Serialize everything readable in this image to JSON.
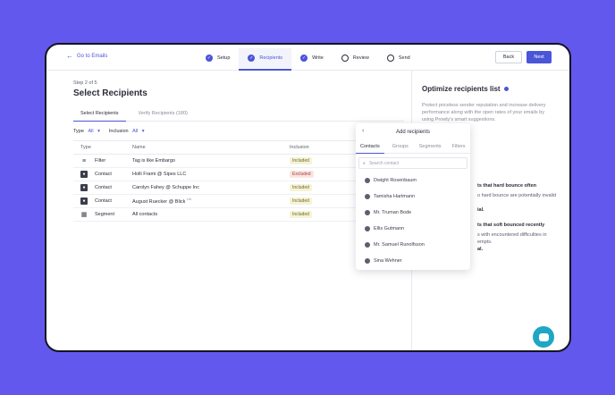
{
  "topbar": {
    "back_label": "Go to Emails",
    "steps": [
      {
        "label": "Setup",
        "done": true
      },
      {
        "label": "Recipients",
        "done": true,
        "active": true
      },
      {
        "label": "Write",
        "done": true
      },
      {
        "label": "Review",
        "done": false
      },
      {
        "label": "Send",
        "done": false
      }
    ],
    "back_button": "Back",
    "next_button": "Next"
  },
  "main": {
    "step_of": "Step 2 of 5",
    "title": "Select Recipients",
    "tabs": [
      "Select Recipients",
      "Verify Recipients (180)"
    ],
    "filters": {
      "type_label": "Type",
      "type_value": "All",
      "inclusion_label": "Inclusion",
      "inclusion_value": "All"
    },
    "table": {
      "headers": [
        "Type",
        "Name",
        "Inclusion"
      ],
      "rows": [
        {
          "type": "Filter",
          "icon": "filter-icon",
          "name": "Tag is like Embargo",
          "inclusion": "Included"
        },
        {
          "type": "Contact",
          "icon": "contact-icon",
          "name": "Holli Frami @ Sipes LLC",
          "inclusion": "Excluded"
        },
        {
          "type": "Contact",
          "icon": "contact-icon",
          "name": "Carolyn Fahey @ Schuppe Inc",
          "inclusion": "Included"
        },
        {
          "type": "Contact",
          "icon": "contact-icon",
          "name": "August Ruecker @ Blick",
          "tag": "Ltd",
          "inclusion": "Included"
        },
        {
          "type": "Segment",
          "icon": "segment-icon",
          "name": "All contacts",
          "inclusion": "Included"
        }
      ]
    }
  },
  "sidebar": {
    "title": "Optimize recipients list",
    "description": "Protect priceless sender reputation and increase delivery performance along with the open rates of your emails by using Prowly's smart suggestions.",
    "hard_heading": "ts that hard bounce often",
    "hard_text": "o hard bounce are potentially invalid",
    "hard_tail": "ial.",
    "soft_heading": "ts that soft bounced recently",
    "soft_text1": "s with encountered difficulties in",
    "soft_text2": "empts.",
    "soft_tail": "al."
  },
  "popup": {
    "title": "Add recipients",
    "tabs": [
      "Contacts",
      "Groups",
      "Segments",
      "Filters"
    ],
    "search_placeholder": "Search contact",
    "contacts": [
      "Dwight Rosenbaum",
      "Tamisha Hartmann",
      "Mr. Truman Bode",
      "Ellis Gutmann",
      "Mr. Samuel Runolfsson",
      "Sina Wehner"
    ]
  },
  "colors": {
    "accent": "#4a55d8",
    "background": "#6258ee",
    "chat": "#1ea7c4"
  }
}
